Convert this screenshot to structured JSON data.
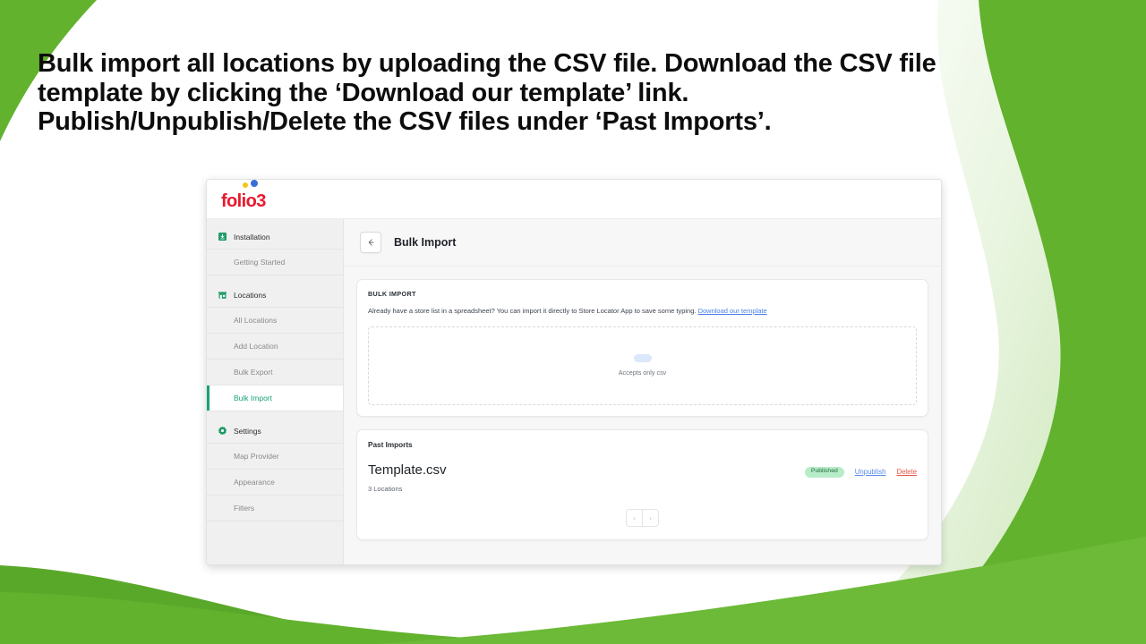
{
  "slide": {
    "heading_lines": [
      "Bulk import all locations by uploading the CSV file. Download the CSV file",
      "template by clicking the ‘Download our template’ link.",
      "Publish/Unpublish/Delete the CSV files under ‘Past Imports’."
    ]
  },
  "colors": {
    "brand_green": "#62b22e",
    "brand_green_light": "#eaf5e2",
    "logo_red": "#e8192c",
    "logo_yellow": "#f5c518",
    "logo_blue": "#3b6fd4",
    "accent_teal": "#1aa179",
    "link_blue": "#4a82e8",
    "danger_red": "#e8564a",
    "badge_green_bg": "#b7ecc8",
    "badge_green_text": "#1f6b3d"
  },
  "app": {
    "brand": {
      "name": "folio3",
      "dot_yellow_icon": "dot-icon",
      "dot_blue_icon": "dot-icon"
    },
    "sidebar": {
      "groups": [
        {
          "label": "Installation",
          "icon": "installation-box-icon",
          "items": [
            {
              "label": "Getting Started",
              "active": false
            }
          ]
        },
        {
          "label": "Locations",
          "icon": "store-front-icon",
          "items": [
            {
              "label": "All Locations",
              "active": false
            },
            {
              "label": "Add Location",
              "active": false
            },
            {
              "label": "Bulk Export",
              "active": false
            },
            {
              "label": "Bulk Import",
              "active": true
            }
          ]
        },
        {
          "label": "Settings",
          "icon": "gear-icon",
          "items": [
            {
              "label": "Map Provider",
              "active": false
            },
            {
              "label": "Appearance",
              "active": false
            },
            {
              "label": "Filters",
              "active": false
            }
          ]
        }
      ]
    },
    "page": {
      "back_icon": "arrow-left-icon",
      "title": "Bulk Import"
    },
    "bulk_import": {
      "section_label": "BULK IMPORT",
      "description": "Already have a store list in a spreadsheet? You can import it directly to Store Locator App to save some typing.",
      "download_link": "Download our template",
      "dropzone": {
        "hint": "Accepts only csv"
      }
    },
    "past_imports": {
      "title": "Past Imports",
      "rows": [
        {
          "file_name": "Template.csv",
          "meta": "3 Locations",
          "status": "Published",
          "unpublish_label": "Unpublish",
          "delete_label": "Delete"
        }
      ],
      "pagination": {
        "prev_icon": "chevron-left-icon",
        "prev_label": "‹",
        "next_icon": "chevron-right-icon",
        "next_label": "›"
      }
    }
  }
}
